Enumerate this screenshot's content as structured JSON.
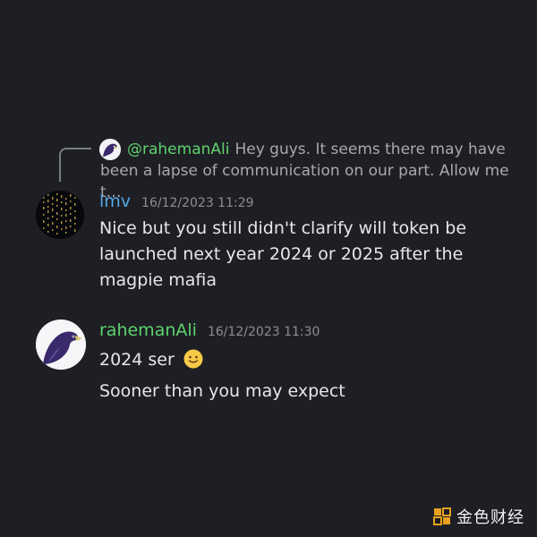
{
  "reply": {
    "mention": "@rahemanAli",
    "preview": "Hey guys. It seems there may have been a lapse of communication on our part. Allow me t…"
  },
  "messages": [
    {
      "author": "lmv",
      "timestamp": "16/12/2023 11:29",
      "lines": [
        "Nice but you still didn't clarify will token be launched next year 2024 or 2025 after the magpie mafia"
      ]
    },
    {
      "author": "rahemanAli",
      "timestamp": "16/12/2023 11:30",
      "lines": [
        "2024 ser",
        "Sooner than you may expect"
      ],
      "emoji": "slightly-smiling-face"
    }
  ],
  "watermark": {
    "text": "金色财经"
  },
  "colors": {
    "background": "#1e1f24",
    "author_lmv": "#56a8e6",
    "author_raheman": "#5ed36c",
    "mention": "#5ed36c",
    "timestamp": "#8d8f95",
    "text": "#e6e7ea"
  }
}
